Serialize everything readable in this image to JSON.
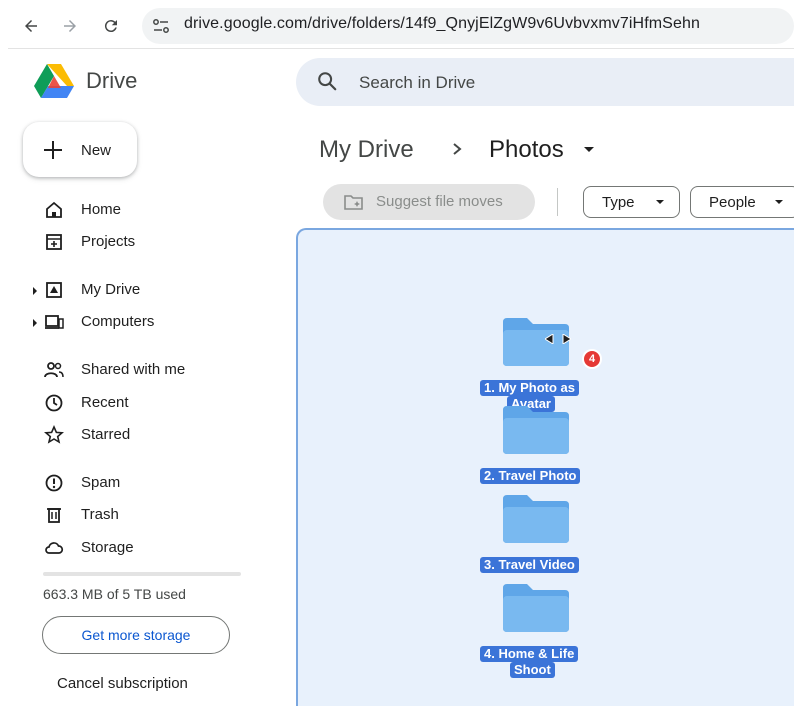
{
  "browser": {
    "url": "drive.google.com/drive/folders/14f9_QnyjElZgW9v6Uvbvxmv7iHfmSehn"
  },
  "app": {
    "name": "Drive",
    "search_placeholder": "Search in Drive",
    "new_label": "New"
  },
  "sidebar": {
    "items": [
      {
        "label": "Home",
        "icon": "home-icon"
      },
      {
        "label": "Projects",
        "icon": "projects-icon"
      },
      {
        "label": "My Drive",
        "icon": "my-drive-icon"
      },
      {
        "label": "Computers",
        "icon": "computers-icon"
      },
      {
        "label": "Shared with me",
        "icon": "shared-icon"
      },
      {
        "label": "Recent",
        "icon": "clock-icon"
      },
      {
        "label": "Starred",
        "icon": "star-icon"
      },
      {
        "label": "Spam",
        "icon": "spam-icon"
      },
      {
        "label": "Trash",
        "icon": "trash-icon"
      },
      {
        "label": "Storage",
        "icon": "cloud-icon"
      }
    ],
    "storage_used": "663.3 MB of 5 TB used",
    "get_storage_label": "Get more storage",
    "cancel_label": "Cancel subscription"
  },
  "breadcrumb": {
    "root": "My Drive",
    "current": "Photos"
  },
  "toolbar": {
    "suggest_label": "Suggest file moves",
    "filters": [
      "Type",
      "People"
    ]
  },
  "folders": [
    {
      "label_line1": "1. My Photo as",
      "label_line2": "Avatar"
    },
    {
      "label_line1": "2. Travel Photo",
      "label_line2": ""
    },
    {
      "label_line1": "3. Travel Video",
      "label_line2": ""
    },
    {
      "label_line1": "4. Home & Life",
      "label_line2": "Shoot"
    }
  ],
  "drag": {
    "count": "4"
  },
  "colors": {
    "accent": "#0b57d0",
    "drop_zone": "#e8f1fc",
    "folder_label_bg": "#3b74d8",
    "folder_fill": "#6aaeea",
    "badge": "#e53935"
  }
}
